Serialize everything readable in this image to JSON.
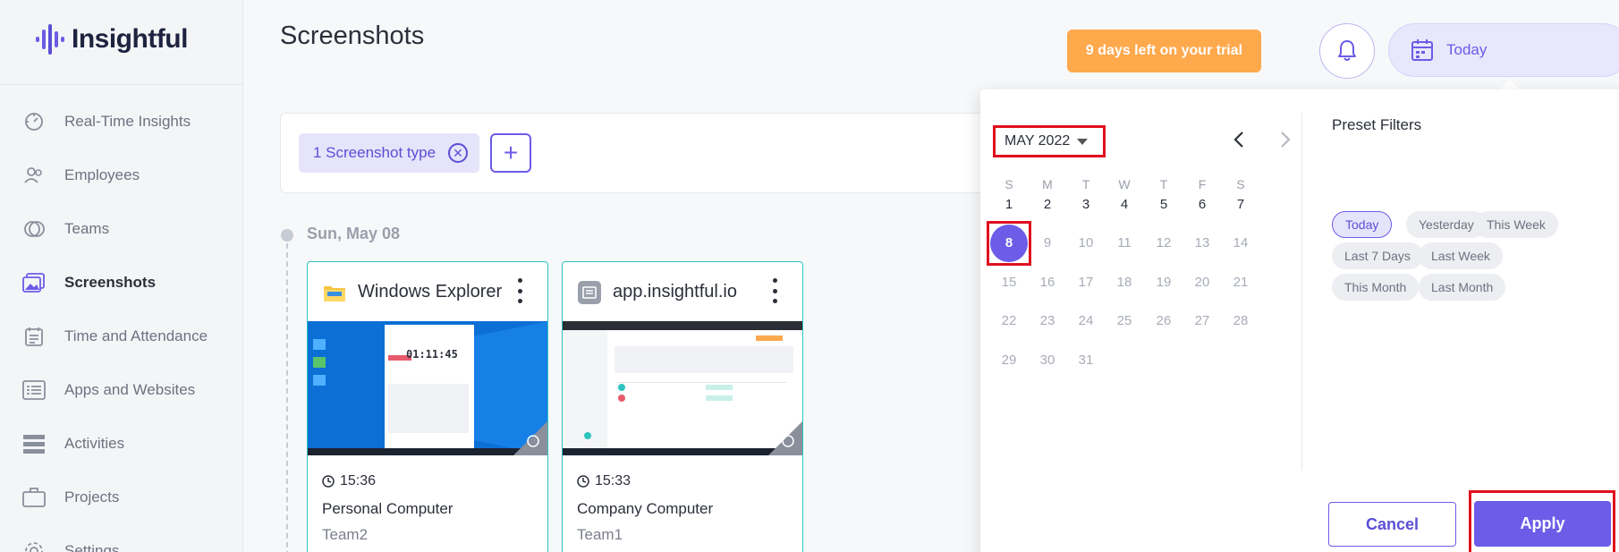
{
  "brand": {
    "name": "Insightful"
  },
  "sidebar": {
    "items": [
      {
        "label": "Real-Time Insights",
        "icon": "gauge-icon"
      },
      {
        "label": "Employees",
        "icon": "people-icon"
      },
      {
        "label": "Teams",
        "icon": "teams-icon"
      },
      {
        "label": "Screenshots",
        "icon": "images-icon",
        "active": true
      },
      {
        "label": "Time and Attendance",
        "icon": "calendar-list-icon"
      },
      {
        "label": "Apps and Websites",
        "icon": "browser-list-icon"
      },
      {
        "label": "Activities",
        "icon": "stack-icon"
      },
      {
        "label": "Projects",
        "icon": "briefcase-icon"
      },
      {
        "label": "Settings",
        "icon": "gear-icon"
      }
    ]
  },
  "header": {
    "title": "Screenshots",
    "trial": "9 days left on your trial",
    "date_button": "Today"
  },
  "filters": {
    "chip_label": "1 Screenshot type",
    "add_label": "+"
  },
  "timeline": {
    "date": "Sun, May 08"
  },
  "cards": [
    {
      "app": "Windows Explorer",
      "time": "15:36",
      "device": "Personal Computer",
      "team": "Team2",
      "thumb_timer": "01:11:45"
    },
    {
      "app": "app.insightful.io",
      "time": "15:33",
      "device": "Company Computer",
      "team": "Team1",
      "thumb_timer": ""
    }
  ],
  "picker": {
    "month": "MAY 2022",
    "weekdays": [
      "S",
      "M",
      "T",
      "W",
      "T",
      "F",
      "S"
    ],
    "selected_day": 8,
    "last_enabled_day": 8,
    "days_in_month": 31,
    "first_weekday": 0,
    "preset_title": "Preset Filters",
    "presets": [
      {
        "label": "Today",
        "active": true
      },
      {
        "label": "Yesterday"
      },
      {
        "label": "This Week"
      },
      {
        "label": "Last 7 Days"
      },
      {
        "label": "Last Week"
      },
      {
        "label": "This Month"
      },
      {
        "label": "Last Month"
      }
    ],
    "cancel": "Cancel",
    "apply": "Apply"
  },
  "colors": {
    "accent": "#6c5ce7",
    "trial": "#ffa94d",
    "card_border": "#2ec4c0",
    "highlight": "#e0101f"
  }
}
